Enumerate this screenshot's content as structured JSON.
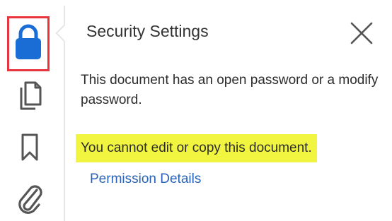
{
  "panel": {
    "title": "Security Settings",
    "description": "This document has an open password or a modify password.",
    "restriction": "You cannot edit or copy this document.",
    "link_label": "Permission Details"
  },
  "rail": {
    "items": [
      {
        "icon": "lock-icon",
        "active": true
      },
      {
        "icon": "pages-icon",
        "active": false
      },
      {
        "icon": "bookmark-icon",
        "active": false
      },
      {
        "icon": "paperclip-icon",
        "active": false
      }
    ]
  },
  "colors": {
    "lock": "#1a6dd4",
    "highlight_border": "#e8343d",
    "restriction_highlight": "#f2f540",
    "link": "#2a63b8",
    "icon_gray": "#555555"
  }
}
